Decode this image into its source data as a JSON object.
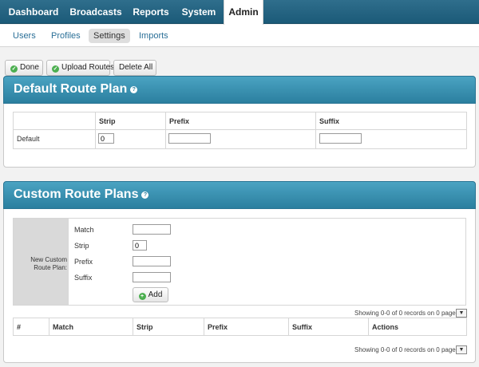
{
  "topnav": {
    "tabs": [
      "Dashboard",
      "Broadcasts",
      "Reports",
      "System",
      "Admin"
    ],
    "active": "Admin"
  },
  "subnav": {
    "items": [
      "Users",
      "Profiles",
      "Settings",
      "Imports"
    ],
    "active": "Settings"
  },
  "toolbar": {
    "done_label": "Done",
    "upload_label": "Upload Routes",
    "delete_label": "Delete All"
  },
  "default_plan": {
    "title": "Default Route Plan",
    "help_icon": "help-icon",
    "columns": [
      "Strip",
      "Prefix",
      "Suffix"
    ],
    "row_label": "Default",
    "strip_value": "0",
    "prefix_value": "",
    "suffix_value": ""
  },
  "custom_plans": {
    "title": "Custom Route Plans",
    "new_label": "New Custom Route Plan:",
    "fields": {
      "match_label": "Match",
      "strip_label": "Strip",
      "prefix_label": "Prefix",
      "suffix_label": "Suffix",
      "match_value": "",
      "strip_value": "0",
      "prefix_value": "",
      "suffix_value": ""
    },
    "add_label": "Add",
    "pager_text": "Showing 0-0 of 0 records on 0 pages.",
    "columns": [
      "#",
      "Match",
      "Strip",
      "Prefix",
      "Suffix",
      "Actions"
    ]
  },
  "colors": {
    "accent": "#2b7f9f",
    "nav": "#1b5a78",
    "ok": "#4caf50"
  }
}
